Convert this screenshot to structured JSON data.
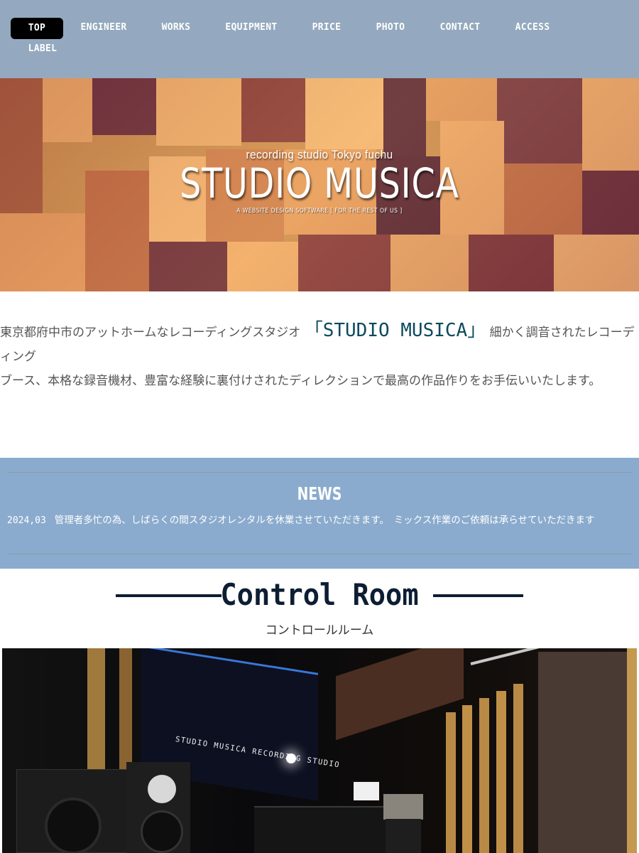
{
  "nav": {
    "items": [
      {
        "label": "TOP",
        "active": true
      },
      {
        "label": "ENGINEER",
        "active": false
      },
      {
        "label": "WORKS",
        "active": false
      },
      {
        "label": "EQUIPMENT",
        "active": false
      },
      {
        "label": "PRICE",
        "active": false
      },
      {
        "label": "PHOTO",
        "active": false
      },
      {
        "label": "CONTACT",
        "active": false
      },
      {
        "label": "ACCESS",
        "active": false
      },
      {
        "label": "LABEL",
        "active": false
      }
    ]
  },
  "hero": {
    "subtitle": "recording studio Tokyo fuchu",
    "title": "STUDIO MUSICA",
    "tagline": "A WEBSITE DESIGN SOFTWARE [ FOR THE REST OF US ]"
  },
  "intro": {
    "part1": "東京都府中市のアットホームなレコーディングスタジオ ",
    "brand": "「STUDIO MUSICA」",
    "part2": " 細かく調音されたレコーディング",
    "part3": "ブース、本格な録音機材、豊富な経験に裏付けされたディレクションで最高の作品作りをお手伝いいたします。"
  },
  "news": {
    "title": "NEWS",
    "items": [
      {
        "date": "2024,03",
        "text": "管理者多忙の為、しばらくの間スタジオレンタルを休業させていただきます。　ミックス作業のご依頼は承らせていただきます"
      }
    ]
  },
  "control_room": {
    "title": "Control Room",
    "subtitle": "コントロールルーム",
    "photo_screen_text": "STUDIO MUSICA RECORDING STUDIO"
  },
  "colors": {
    "nav_bg": "#94a9bf",
    "news_bg": "#8aabcd",
    "brand_text": "#0c4a5e",
    "heading": "#0d1e33"
  }
}
